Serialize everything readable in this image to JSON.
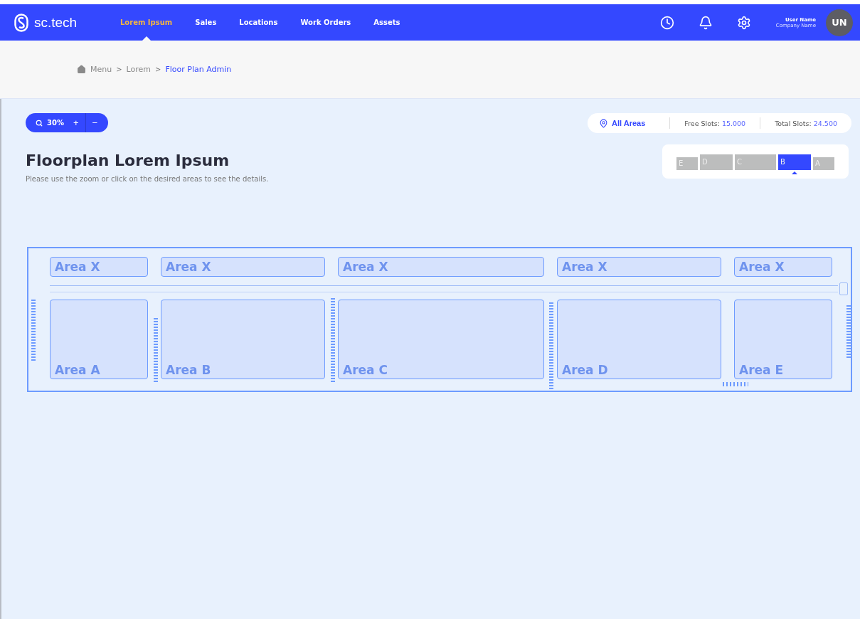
{
  "brand": {
    "name": "sc.tech"
  },
  "nav": [
    {
      "label": "Lorem Ipsum",
      "selected": true
    },
    {
      "label": "Sales",
      "selected": false
    },
    {
      "label": "Locations",
      "selected": false
    },
    {
      "label": "Work Orders",
      "selected": false
    },
    {
      "label": "Assets",
      "selected": false
    }
  ],
  "user": {
    "name": "User Name",
    "company": "Company Name",
    "initials": "UN"
  },
  "breadcrumb": [
    {
      "label": "Menu",
      "current": false
    },
    {
      "label": "Lorem",
      "current": false
    },
    {
      "label": "Floor Plan Admin",
      "current": true
    }
  ],
  "separator": ">",
  "zoom": {
    "value": "30%",
    "plus": "+",
    "minus": "−"
  },
  "stats": {
    "filter": "All Areas",
    "free_label": "Free Slots:",
    "free_value": "15.000",
    "total_label": "Total Slots:",
    "total_value": "24.500"
  },
  "minimap": [
    {
      "label": "E",
      "selected": false
    },
    {
      "label": "D",
      "selected": false
    },
    {
      "label": "C",
      "selected": false
    },
    {
      "label": "B",
      "selected": true
    },
    {
      "label": "A",
      "selected": false
    }
  ],
  "title": "Floorplan Lorem Ipsum",
  "subtitle": "Please use the zoom or click on the desired areas to see the details.",
  "plan": {
    "top_areas": [
      "Area X",
      "Area X",
      "Area X",
      "Area X",
      "Area X"
    ],
    "areas": [
      "Area A",
      "Area B",
      "Area C",
      "Area D",
      "Area E"
    ]
  }
}
